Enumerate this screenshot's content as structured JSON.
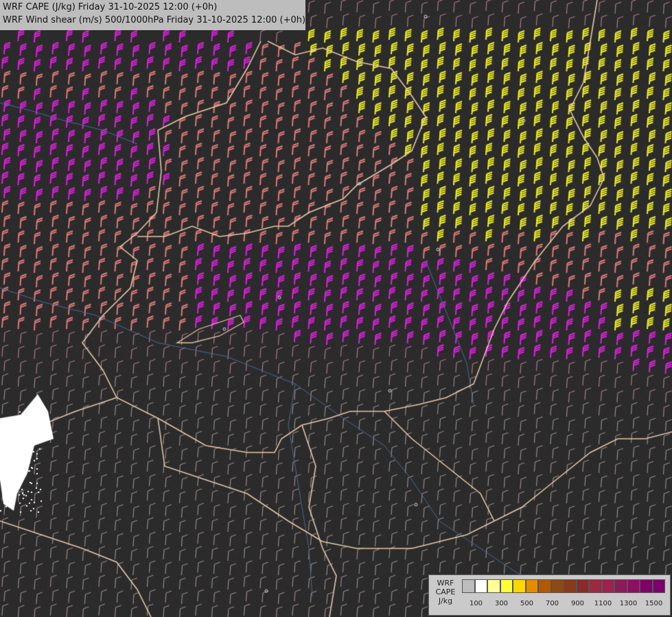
{
  "title": {
    "line1": "WRF CAPE (J/kg) Friday 31-10-2025 12:00 (+0h)",
    "line2": "WRF Wind shear (m/s) 500/1000hPa Friday 31-10-2025 12:00 (+0h)"
  },
  "legend": {
    "label_line1": "WRF",
    "label_line2": "CAPE",
    "label_line3": "J/kg",
    "colors": [
      "#bcbcbc",
      "#ffffff",
      "#ffff99",
      "#ffff33",
      "#ffd700",
      "#e68a00",
      "#b35900",
      "#8c4a14",
      "#8a3a1a",
      "#8b2a2a",
      "#9a2a40",
      "#a02050",
      "#8b1a5a",
      "#8a1060",
      "#80006a",
      "#7a0070"
    ],
    "ticks": [
      {
        "label": "100",
        "index": 1
      },
      {
        "label": "300",
        "index": 3
      },
      {
        "label": "500",
        "index": 5
      },
      {
        "label": "700",
        "index": 7
      },
      {
        "label": "900",
        "index": 9
      },
      {
        "label": "1100",
        "index": 11
      },
      {
        "label": "1300",
        "index": 13
      },
      {
        "label": "1500",
        "index": 15
      }
    ]
  },
  "map_colors": {
    "magenta": "#e020e0",
    "salmon": "#e07a78",
    "yellow": "#f0f020",
    "mauve": "#b07a88",
    "gray": "#9a8a8a",
    "border": "#e8c8a8",
    "river": "#4a6a9a",
    "snow": "#ffffff"
  }
}
